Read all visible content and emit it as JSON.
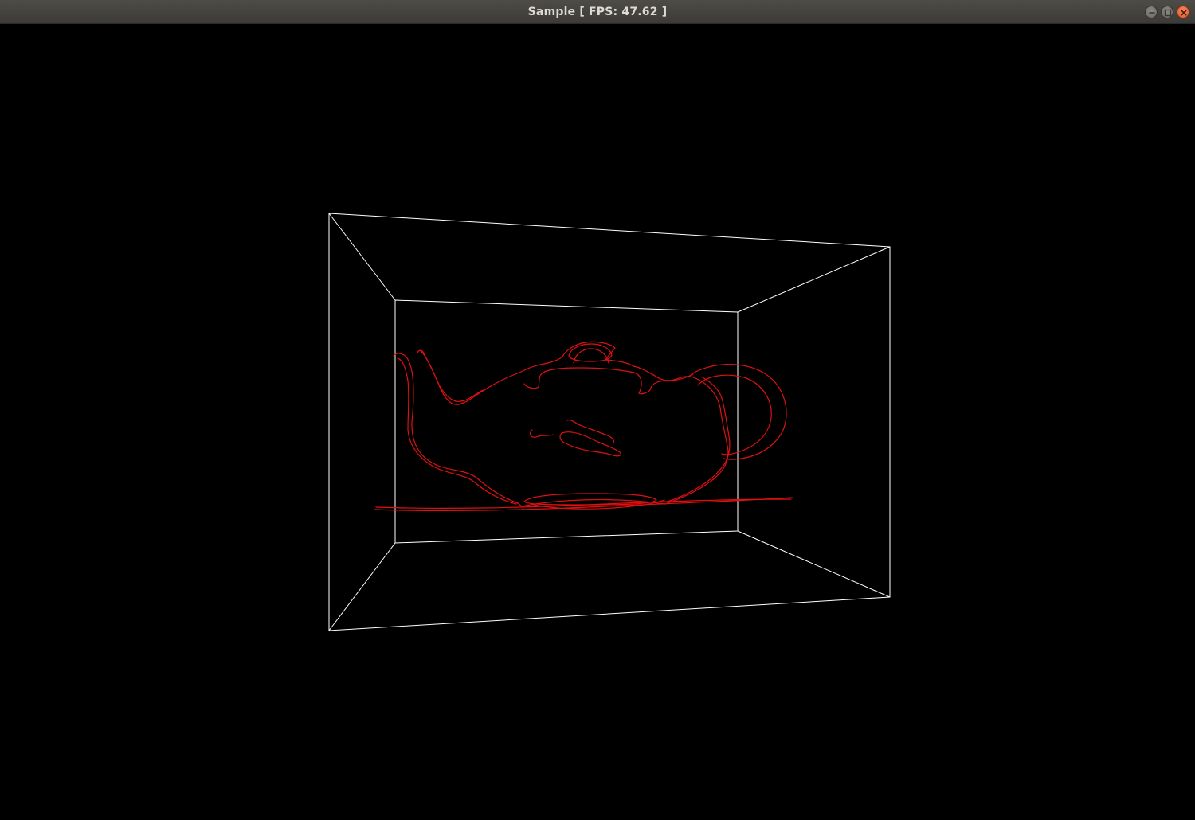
{
  "window": {
    "title": "Sample [ FPS: 47.62 ]",
    "controls": [
      "minimize-icon",
      "maximize-icon",
      "close-icon"
    ]
  },
  "scene": {
    "background_color": "#000000",
    "box_color": "#ffffff",
    "model_color": "#e01010",
    "model": "teapot-icon"
  }
}
